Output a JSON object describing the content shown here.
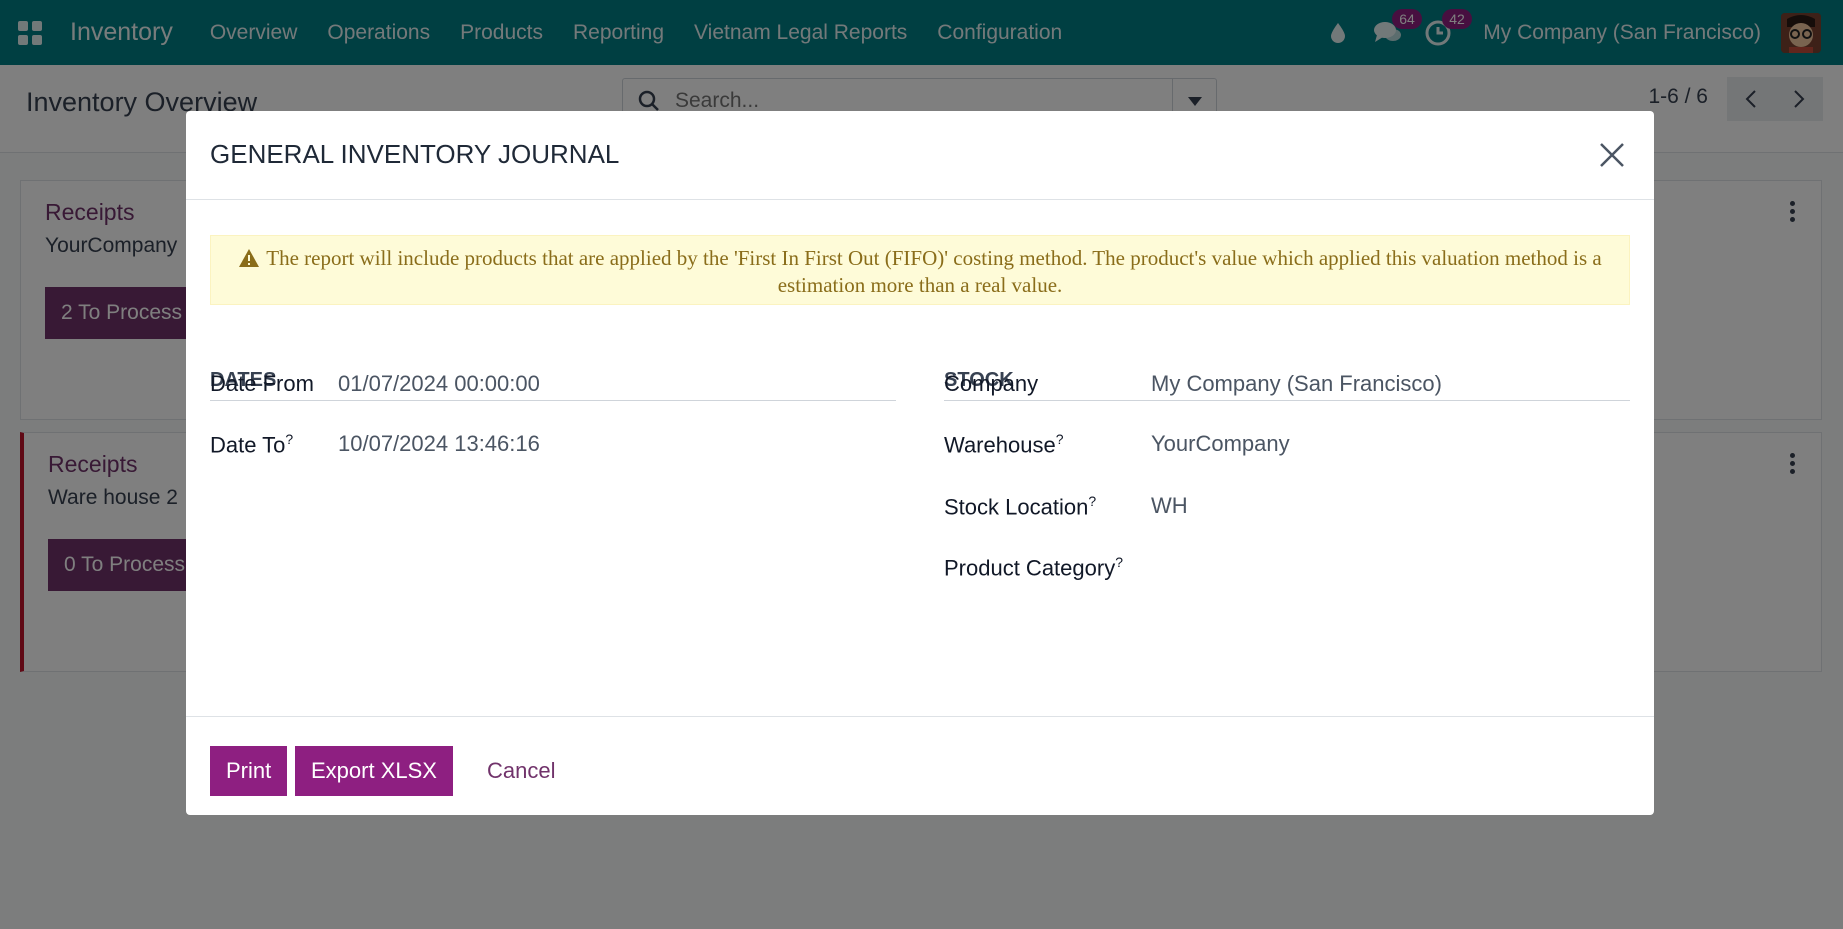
{
  "navbar": {
    "app_name": "Inventory",
    "menu": [
      "Overview",
      "Operations",
      "Products",
      "Reporting",
      "Vietnam Legal Reports",
      "Configuration"
    ],
    "messages_count": "64",
    "activities_count": "42",
    "company": "My Company (San Francisco)"
  },
  "control_panel": {
    "title": "Inventory Overview",
    "search_placeholder": "Search...",
    "pager": "1-6 / 6"
  },
  "cards": [
    {
      "title": "Receipts",
      "subtitle": "YourCompany",
      "button": "2 To Process"
    },
    {
      "title": "Receipts",
      "subtitle": "Ware house 2",
      "button": "0 To Process"
    }
  ],
  "modal": {
    "title": "GENERAL INVENTORY JOURNAL",
    "alert": "The report will include products that are applied by the 'First In First Out (FIFO)' costing method. The product's value which applied this valuation method is a estimation more than a real value.",
    "dates_section": "DATES",
    "stock_section": "STOCK",
    "date_from_label": "Date From",
    "date_from_value": "01/07/2024 00:00:00",
    "date_to_label": "Date To",
    "date_to_value": "10/07/2024 13:46:16",
    "company_label": "Company",
    "company_value": "My Company (San Francisco)",
    "warehouse_label": "Warehouse",
    "warehouse_value": "YourCompany",
    "location_label": "Stock Location",
    "location_value": "WH",
    "category_label": "Product Category",
    "category_value": "",
    "help_mark": "?",
    "buttons": {
      "print": "Print",
      "export": "Export XLSX",
      "cancel": "Cancel"
    }
  },
  "colors": {
    "navbar": "#017e84",
    "primary": "#8e1f81",
    "card_accent": "#71336b",
    "alert_bg": "#fefbd8",
    "alert_text": "#8a6d1a"
  }
}
